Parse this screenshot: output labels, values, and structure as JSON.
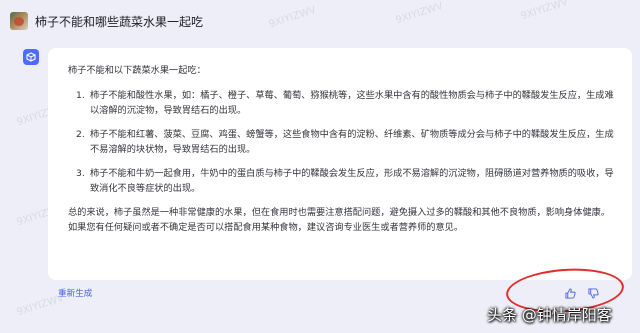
{
  "question": "柿子不能和哪些蔬菜水果一起吃",
  "answer": {
    "intro": "柿子不能和以下蔬菜水果一起吃：",
    "points": [
      {
        "num": "1.",
        "text": "柿子不能和酸性水果，如：橘子、橙子、草莓、葡萄、猕猴桃等，这些水果中含有的酸性物质会与柿子中的鞣酸发生反应，生成难以溶解的沉淀物，导致胃结石的出现。"
      },
      {
        "num": "2.",
        "text": "柿子不能和红薯、菠菜、豆腐、鸡蛋、螃蟹等，这些食物中含有的淀粉、纤维素、矿物质等成分会与柿子中的鞣酸发生反应，生成不易溶解的块状物，导致胃结石的出现。"
      },
      {
        "num": "3.",
        "text": "柿子不能和牛奶一起食用，牛奶中的蛋白质与柿子中的鞣酸会发生反应，形成不易溶解的沉淀物，阻碍肠道对营养物质的吸收，导致消化不良等症状的出现。"
      }
    ],
    "summary": "总的来说，柿子虽然是一种非常健康的水果，但在食用时也需要注意搭配问题，避免摄入过多的鞣酸和其他不良物质，影响身体健康。如果您有任何疑问或者不确定是否可以搭配食用某种食物，建议咨询专业医生或者营养师的意见。"
  },
  "actions": {
    "regenerate_label": "重新生成",
    "like_icon": "thumbs-up-icon",
    "dislike_icon": "thumbs-down-icon"
  },
  "watermark_text": "9XIYIZWV",
  "footer_credit": "头条 @钟情岸阳客",
  "colors": {
    "page_background": "#edeef7",
    "accent": "#4b6cff",
    "annotation_red": "#e52b2b"
  }
}
